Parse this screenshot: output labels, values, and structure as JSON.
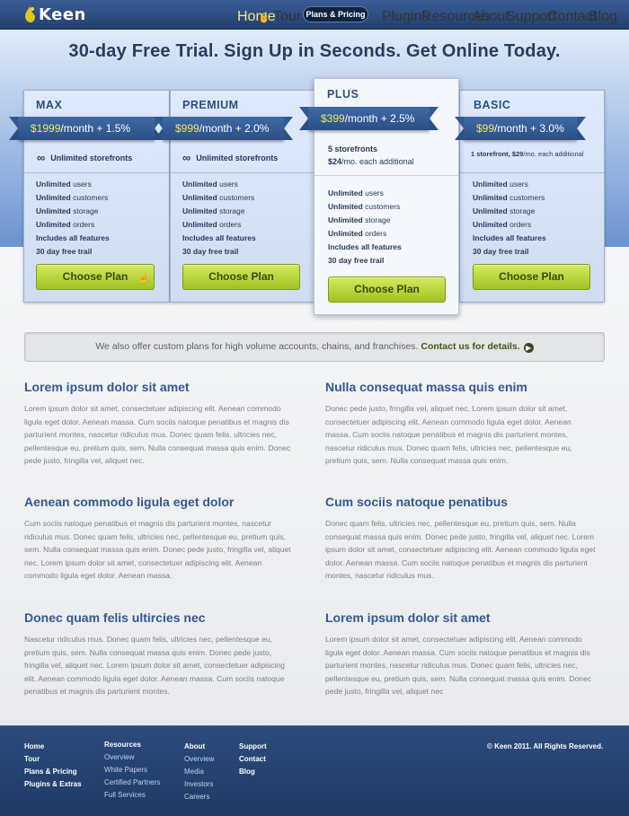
{
  "brand": {
    "name": "Keen"
  },
  "nav": {
    "items": [
      "Home",
      "Tour",
      "Plans & Pricing",
      "Plugins",
      "Resources",
      "About",
      "Support",
      "Contact",
      "Blog"
    ],
    "active": "Home",
    "highlighted": "Plans & Pricing"
  },
  "hero": {
    "title": "30-day Free Trial. Sign Up in Seconds. Get Online Today."
  },
  "plans": [
    {
      "name": "MAX",
      "price": "$1999",
      "price_rest": "/month + 1.5%",
      "storefront_main": "Unlimited storefronts",
      "features": [
        [
          "Unlimited",
          " users"
        ],
        [
          "Unlimited",
          " customers"
        ],
        [
          "Unlimited",
          " storage"
        ],
        [
          "Unlimited",
          " orders"
        ],
        [
          "Includes all features",
          ""
        ],
        [
          "30 day free trail",
          ""
        ]
      ],
      "button": "Choose Plan"
    },
    {
      "name": "PREMIUM",
      "price": "$999",
      "price_rest": "/month + 2.0%",
      "storefront_main": "Unlimited storefronts",
      "features": [
        [
          "Unlimited",
          " users"
        ],
        [
          "Unlimited",
          " customers"
        ],
        [
          "Unlimited",
          " storage"
        ],
        [
          "Unlimited",
          " orders"
        ],
        [
          "Includes all features",
          ""
        ],
        [
          "30 day free trail",
          ""
        ]
      ],
      "button": "Choose Plan"
    },
    {
      "name": "PLUS",
      "price": "$399",
      "price_rest": "/month + 2.5%",
      "storefront_main": "5 storefronts",
      "storefront_sub_price": "$24",
      "storefront_sub_rest": "/mo. each additional",
      "features": [
        [
          "Unlimited",
          " users"
        ],
        [
          "Unlimited",
          " customers"
        ],
        [
          "Unlimited",
          " storage"
        ],
        [
          "Unlimited",
          " orders"
        ],
        [
          "Includes all features",
          ""
        ],
        [
          "30 day free trail",
          ""
        ]
      ],
      "button": "Choose Plan"
    },
    {
      "name": "BASIC",
      "price": "$99",
      "price_rest": "/month + 3.0%",
      "storefront_main": "1 storefront, $29",
      "storefront_sub_rest": "/mo. each additional",
      "features": [
        [
          "Unlimited",
          " users"
        ],
        [
          "Unlimited",
          " customers"
        ],
        [
          "Unlimited",
          " storage"
        ],
        [
          "Unlimited",
          " orders"
        ],
        [
          "Includes all features",
          ""
        ],
        [
          "30 day free trail",
          ""
        ]
      ],
      "button": "Choose Plan"
    }
  ],
  "banner": {
    "text": "We also offer custom plans for high volume accounts, chains, and franchises.",
    "link": "Contact us for details."
  },
  "blocks": [
    {
      "title": "Lorem ipsum dolor sit amet",
      "body": "Lorem ipsum dolor sit amet, consectetuer adipiscing elit. Aenean commodo ligula eget dolor. Aenean massa. Cum sociis natoque penatibus et magnis dis parturient montes, nascetur ridiculus mus. Donec quam felis, ultricies nec, pellentesque eu, pretium quis, sem. Nulla consequat massa quis enim. Donec pede justo, fringilla vel, aliquet nec."
    },
    {
      "title": "Nulla consequat massa quis enim",
      "body": "Donec pede justo, fringilla vel, aliquet nec. Lorem ipsum dolor sit amet, consectetuer adipiscing elit. Aenean commodo ligula eget dolor. Aenean massa. Cum sociis natoque penatibus et magnis dis parturient montes, nascetur ridiculus mus. Donec quam felis, ultricies nec, pellentesque eu, pretium quis, sem. Nulla consequat massa quis enim."
    },
    {
      "title": "Aenean commodo ligula eget dolor",
      "body": "Cum sociis natoque penatibus et magnis dis parturient montes, nascetur ridiculus mus. Donec quam felis, ultricies nec, pellentesque eu, pretium quis, sem. Nulla consequat massa quis enim. Donec pede justo, fringilla vel, aliquet nec. Lorem ipsum dolor sit amet, consectetuer adipiscing elit. Aenean commodo ligula eget dolor. Aenean massa."
    },
    {
      "title": "Cum sociis natoque penatibus",
      "body": "Donec quam felis, ultricies nec, pellentesque eu, pretium quis, sem. Nulla consequat massa quis enim. Donec pede justo, fringilla vel, aliquet nec. Lorem ipsum dolor sit amet, consectetuer adipiscing elit. Aenean commodo ligula eget dolor. Aenean massa. Cum sociis natoque penatibus et magnis dis parturient montes, nascetur ridiculus mus."
    },
    {
      "title": "Donec quam felis ultircies nec",
      "body": "Nascetur ridiculus mus. Donec quam felis, ultricies nec, pellentesque eu, pretium quis, sem. Nulla consequat massa quis enim. Donec pede justo, fringilla vel, aliquet nec. Lorem ipsum dolor sit amet, consectetuer adipiscing elit. Aenean commodo ligula eget dolor. Aenean massa. Cum sociis natoque penatibus et magnis dis parturient montes."
    },
    {
      "title": "Lorem ipsum dolor sit amet",
      "body": "Lorem ipsum dolor sit amet, consectetuer adipiscing elit. Aenean commodo ligula eget dolor. Aenean massa. Cum sociis natoque penatibus et magnis dis parturient montes, nascetur ridiculus mus. Donec quam felis, ultricies nec, pellentesque eu, pretium quis, sem. Nulla consequat massa quis enim. Donec pede justo, fringilla vel, aliquet nec"
    }
  ],
  "footer": {
    "col1": [
      "Home",
      "Tour",
      "Plans & Pricing",
      "Plugins & Extras"
    ],
    "col2": {
      "head": "Resources",
      "items": [
        "Overview",
        "White Papers",
        "Certified Partners",
        "Full Services"
      ]
    },
    "col3": {
      "head": "About",
      "items": [
        "Overview",
        "Media",
        "Investors",
        "Careers"
      ]
    },
    "col4": [
      "Support",
      "Contact",
      "Blog"
    ],
    "copyright": "© Keen 2011. All Rights Reserved."
  },
  "colors": {
    "brand_blue": "#33598f",
    "accent_yellow": "#f2e56a",
    "button_green": "#9fc424",
    "link_green": "#3c5a1a"
  }
}
